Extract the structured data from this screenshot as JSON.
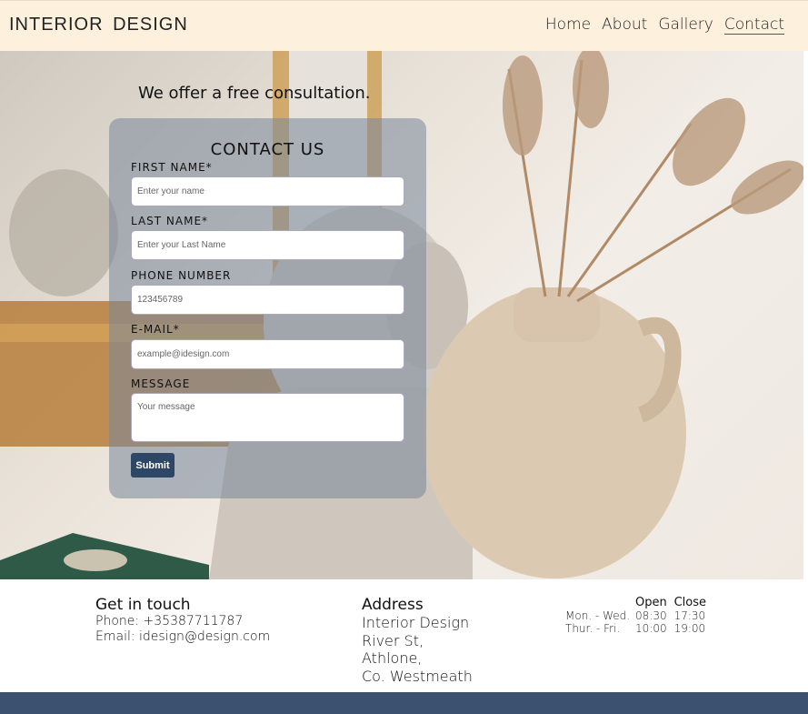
{
  "header": {
    "brand": "INTERIOR  DESIGN",
    "nav": [
      "Home",
      "About",
      "Gallery",
      "Contact"
    ],
    "active": "Contact"
  },
  "hero": {
    "tagline": "We offer a free consultation."
  },
  "form": {
    "title": "CONTACT US",
    "first_name_label": "FIRST NAME*",
    "first_name_placeholder": "Enter your name",
    "last_name_label": "LAST NAME*",
    "last_name_placeholder": "Enter your Last Name",
    "phone_label": "PHONE NUMBER",
    "phone_placeholder": "123456789",
    "email_label": "E-MAIL*",
    "email_placeholder": "example@idesign.com",
    "message_label": "MESSAGE",
    "message_placeholder": "Your message",
    "submit_label": "Submit"
  },
  "footer": {
    "touch_title": "Get in touch",
    "phone": "Phone: +35387711787",
    "email": "Email: idesign@design.com",
    "address_title": "Address",
    "address_lines": [
      "Interior Design",
      "River St,",
      "Athlone,",
      "Co. Westmeath"
    ],
    "hours_headers": [
      "",
      "Open",
      "Close"
    ],
    "hours_rows": [
      [
        "Mon. - Wed.",
        "08:30",
        "17:30"
      ],
      [
        "Thur. - Fri.",
        "10:00",
        "19:00"
      ]
    ]
  },
  "colors": {
    "header_bg": "#fdf1de",
    "form_overlay": "#78879b",
    "submit_bg": "#2f4766",
    "bottom_bar": "#3c5170"
  }
}
